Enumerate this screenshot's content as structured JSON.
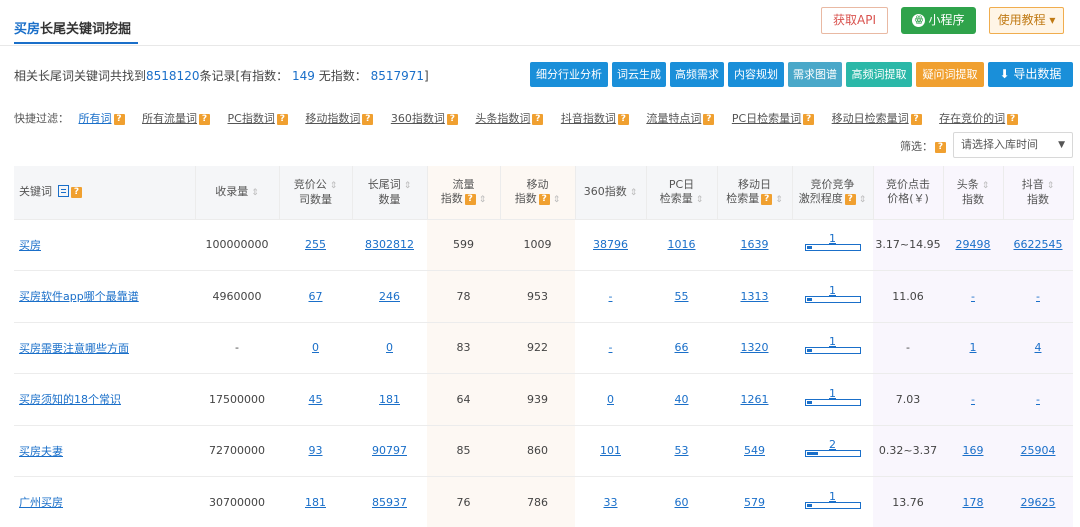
{
  "header": {
    "title_hl": "买房",
    "title_rest": "长尾关键词挖掘",
    "api_label": "获取API",
    "mini_label": "小程序",
    "tutorial_label": "使用教程 ▾"
  },
  "stats": {
    "prefix": "相关长尾词关键词共找到",
    "total": "8518120",
    "mid": "条记录[有指数：",
    "with_index": "149",
    "mid2": "无指数：",
    "without_index": "8517971",
    "suffix": "]"
  },
  "actions": [
    {
      "label": "细分行业分析",
      "color": "#1a8fd9"
    },
    {
      "label": "词云生成",
      "color": "#1a8fd9"
    },
    {
      "label": "高频需求",
      "color": "#1a8fd9"
    },
    {
      "label": "内容规划",
      "color": "#1a8fd9"
    },
    {
      "label": "需求图谱",
      "color": "#4aa8c9"
    },
    {
      "label": "高频词提取",
      "color": "#2bb8a8"
    },
    {
      "label": "疑问词提取",
      "color": "#f0a030"
    },
    {
      "label": "导出数据",
      "color": "#1a8fd9"
    }
  ],
  "filters": {
    "label": "快捷过滤：",
    "items": [
      "所有词",
      "所有流量词",
      "PC指数词",
      "移动指数词",
      "360指数词",
      "头条指数词",
      "抖音指数词",
      "流量特点词",
      "PC日检索量词",
      "移动日检索量词",
      "存在竞价的词"
    ]
  },
  "screen": {
    "label": "筛选：",
    "select_value": "请选择入库时间"
  },
  "table": {
    "headers": {
      "keyword": "关键词",
      "collect": "收录量",
      "bid_company_1": "竞价公",
      "bid_company_2": "司数量",
      "longtail_1": "长尾词",
      "longtail_2": "数量",
      "traffic_1": "流量",
      "traffic_2": "指数",
      "mobile_1": "移动",
      "mobile_2": "指数",
      "idx360": "360指数",
      "pc_1": "PC日",
      "pc_2": "检索量",
      "mday_1": "移动日",
      "mday_2": "检索量",
      "compete_1": "竞价竞争",
      "compete_2": "激烈程度",
      "price_1": "竞价点击",
      "price_2": "价格(￥)",
      "toutiao_1": "头条",
      "toutiao_2": "指数",
      "douyin_1": "抖音",
      "douyin_2": "指数"
    },
    "rows": [
      {
        "kw": "买房",
        "collect": "100000000",
        "bid": "255",
        "longtail": "8302812",
        "traffic": "599",
        "mobile": "1009",
        "i360": "38796",
        "pc": "1016",
        "mday": "1639",
        "compete": "1",
        "compete_level": 0.1,
        "price": "3.17~14.95",
        "toutiao": "29498",
        "douyin": "6622545"
      },
      {
        "kw": "买房软件app哪个最靠谱",
        "collect": "4960000",
        "bid": "67",
        "longtail": "246",
        "traffic": "78",
        "mobile": "953",
        "i360": "-",
        "pc": "55",
        "mday": "1313",
        "compete": "1",
        "compete_level": 0.1,
        "price": "11.06",
        "toutiao": "-",
        "douyin": "-"
      },
      {
        "kw": "买房需要注意哪些方面",
        "collect": "-",
        "bid": "0",
        "longtail": "0",
        "traffic": "83",
        "mobile": "922",
        "i360": "-",
        "pc": "66",
        "mday": "1320",
        "compete": "1",
        "compete_level": 0.1,
        "price": "-",
        "toutiao": "1",
        "douyin": "4"
      },
      {
        "kw": "买房须知的18个常识",
        "collect": "17500000",
        "bid": "45",
        "longtail": "181",
        "traffic": "64",
        "mobile": "939",
        "i360": "0",
        "pc": "40",
        "mday": "1261",
        "compete": "1",
        "compete_level": 0.1,
        "price": "7.03",
        "toutiao": "-",
        "douyin": "-"
      },
      {
        "kw": "买房夫妻",
        "collect": "72700000",
        "bid": "93",
        "longtail": "90797",
        "traffic": "85",
        "mobile": "860",
        "i360": "101",
        "pc": "53",
        "mday": "549",
        "compete": "2",
        "compete_level": 0.2,
        "price": "0.32~3.37",
        "toutiao": "169",
        "douyin": "25904"
      },
      {
        "kw": "广州买房",
        "collect": "30700000",
        "bid": "181",
        "longtail": "85937",
        "traffic": "76",
        "mobile": "786",
        "i360": "33",
        "pc": "60",
        "mday": "579",
        "compete": "1",
        "compete_level": 0.1,
        "price": "13.76",
        "toutiao": "178",
        "douyin": "29625"
      }
    ]
  }
}
